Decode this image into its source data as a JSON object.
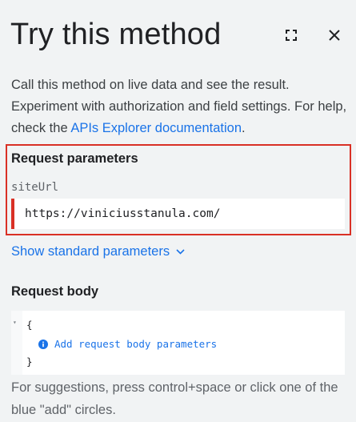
{
  "panel": {
    "title": "Try this method",
    "fullscreen_icon": "fullscreen-icon",
    "close_icon": "close-icon"
  },
  "description": {
    "text": "Call this method on live data and see the result. Experiment with authorization and field settings. For help, check the ",
    "link": "APIs Explorer documentation",
    "suffix": "."
  },
  "request_parameters": {
    "title": "Request parameters",
    "param_name": "siteUrl",
    "param_value": "https://viniciusstanula.com/"
  },
  "standard_parameters": {
    "label": "Show standard parameters"
  },
  "request_body": {
    "title": "Request body",
    "open_brace": "{",
    "close_brace": "}",
    "add_label": "Add request body parameters",
    "hint": "For suggestions, press control+space or click one of the blue \"add\" circles."
  },
  "colors": {
    "accent": "#1a73e8",
    "highlight": "#d93025",
    "background": "#f1f3f4"
  }
}
